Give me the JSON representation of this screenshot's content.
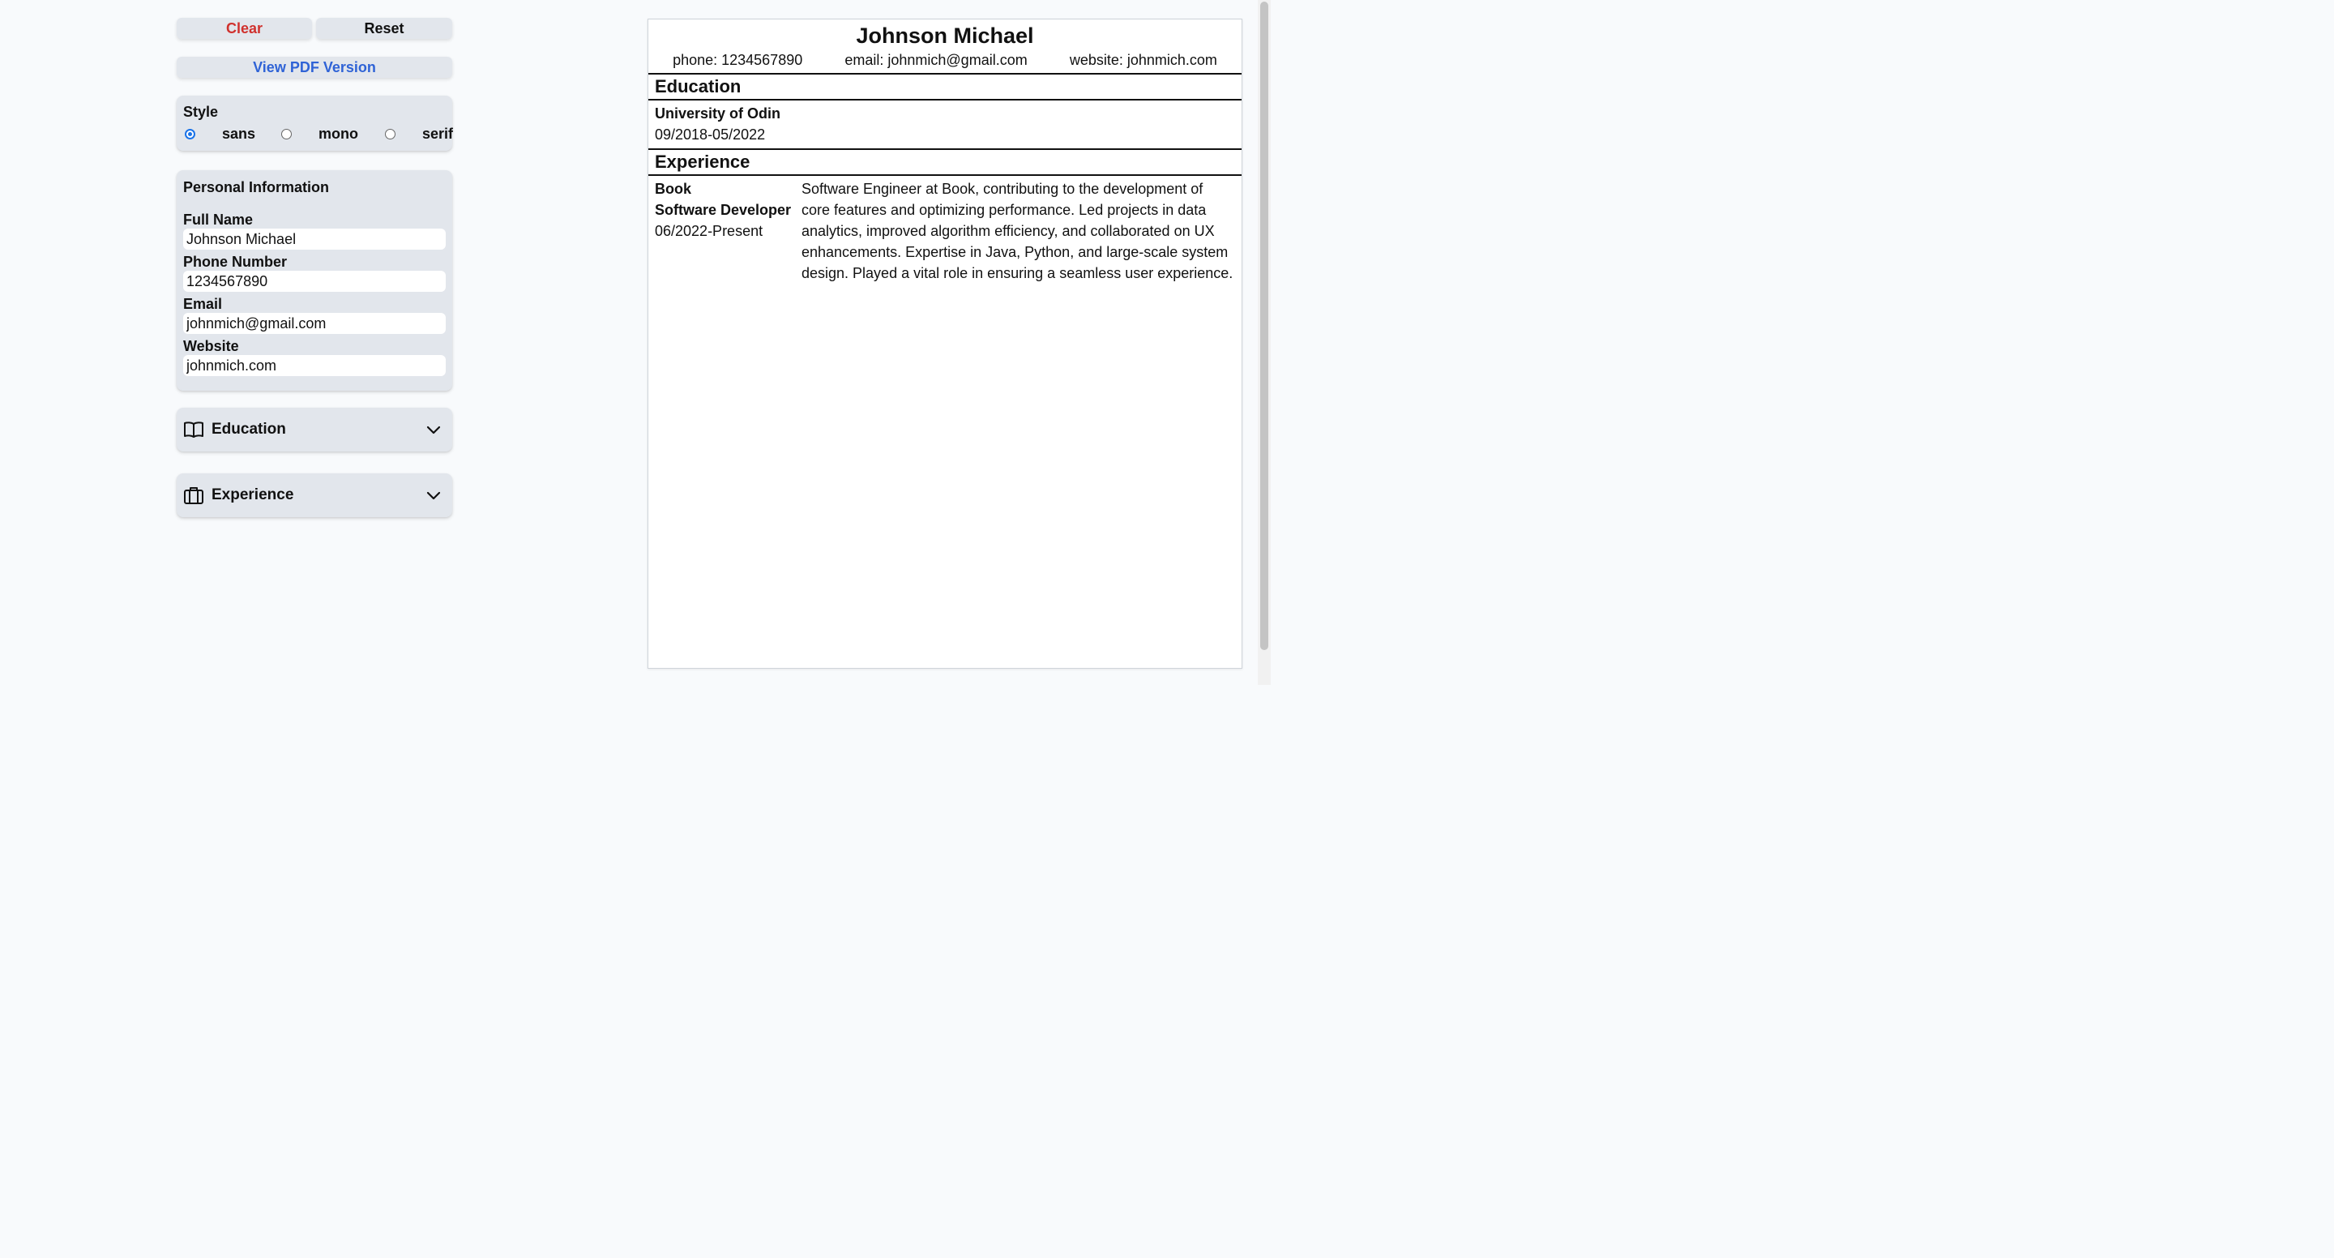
{
  "toolbar": {
    "clear_label": "Clear",
    "reset_label": "Reset",
    "pdf_label": "View PDF Version"
  },
  "style": {
    "label": "Style",
    "options": [
      "sans",
      "mono",
      "serif"
    ],
    "selected": "sans"
  },
  "personal": {
    "title": "Personal Information",
    "full_name_label": "Full Name",
    "full_name": "Johnson Michael",
    "phone_label": "Phone Number",
    "phone": "1234567890",
    "email_label": "Email",
    "email": "johnmich@gmail.com",
    "website_label": "Website",
    "website": "johnmich.com"
  },
  "sections": {
    "education_label": "Education",
    "experience_label": "Experience"
  },
  "resume": {
    "name": "Johnson Michael",
    "phone_text": "phone: 1234567890",
    "email_text": "email: johnmich@gmail.com",
    "website_text": "website: johnmich.com",
    "education_heading": "Education",
    "school": "University of Odin",
    "school_dates": "09/2018-05/2022",
    "experience_heading": "Experience",
    "company": "Book",
    "position": "Software Developer",
    "job_dates": "06/2022-Present",
    "job_description": "Software Engineer at Book, contributing to the development of core features and optimizing performance. Led projects in data analytics, improved algorithm efficiency, and collaborated on UX enhancements. Expertise in Java, Python, and large-scale system design. Played a vital role in ensuring a seamless user experience."
  },
  "colors": {
    "clear": "#d0312d",
    "link": "#2f63d6",
    "card_bg": "#e2e6ec",
    "page_bg": "#f8fafc"
  }
}
